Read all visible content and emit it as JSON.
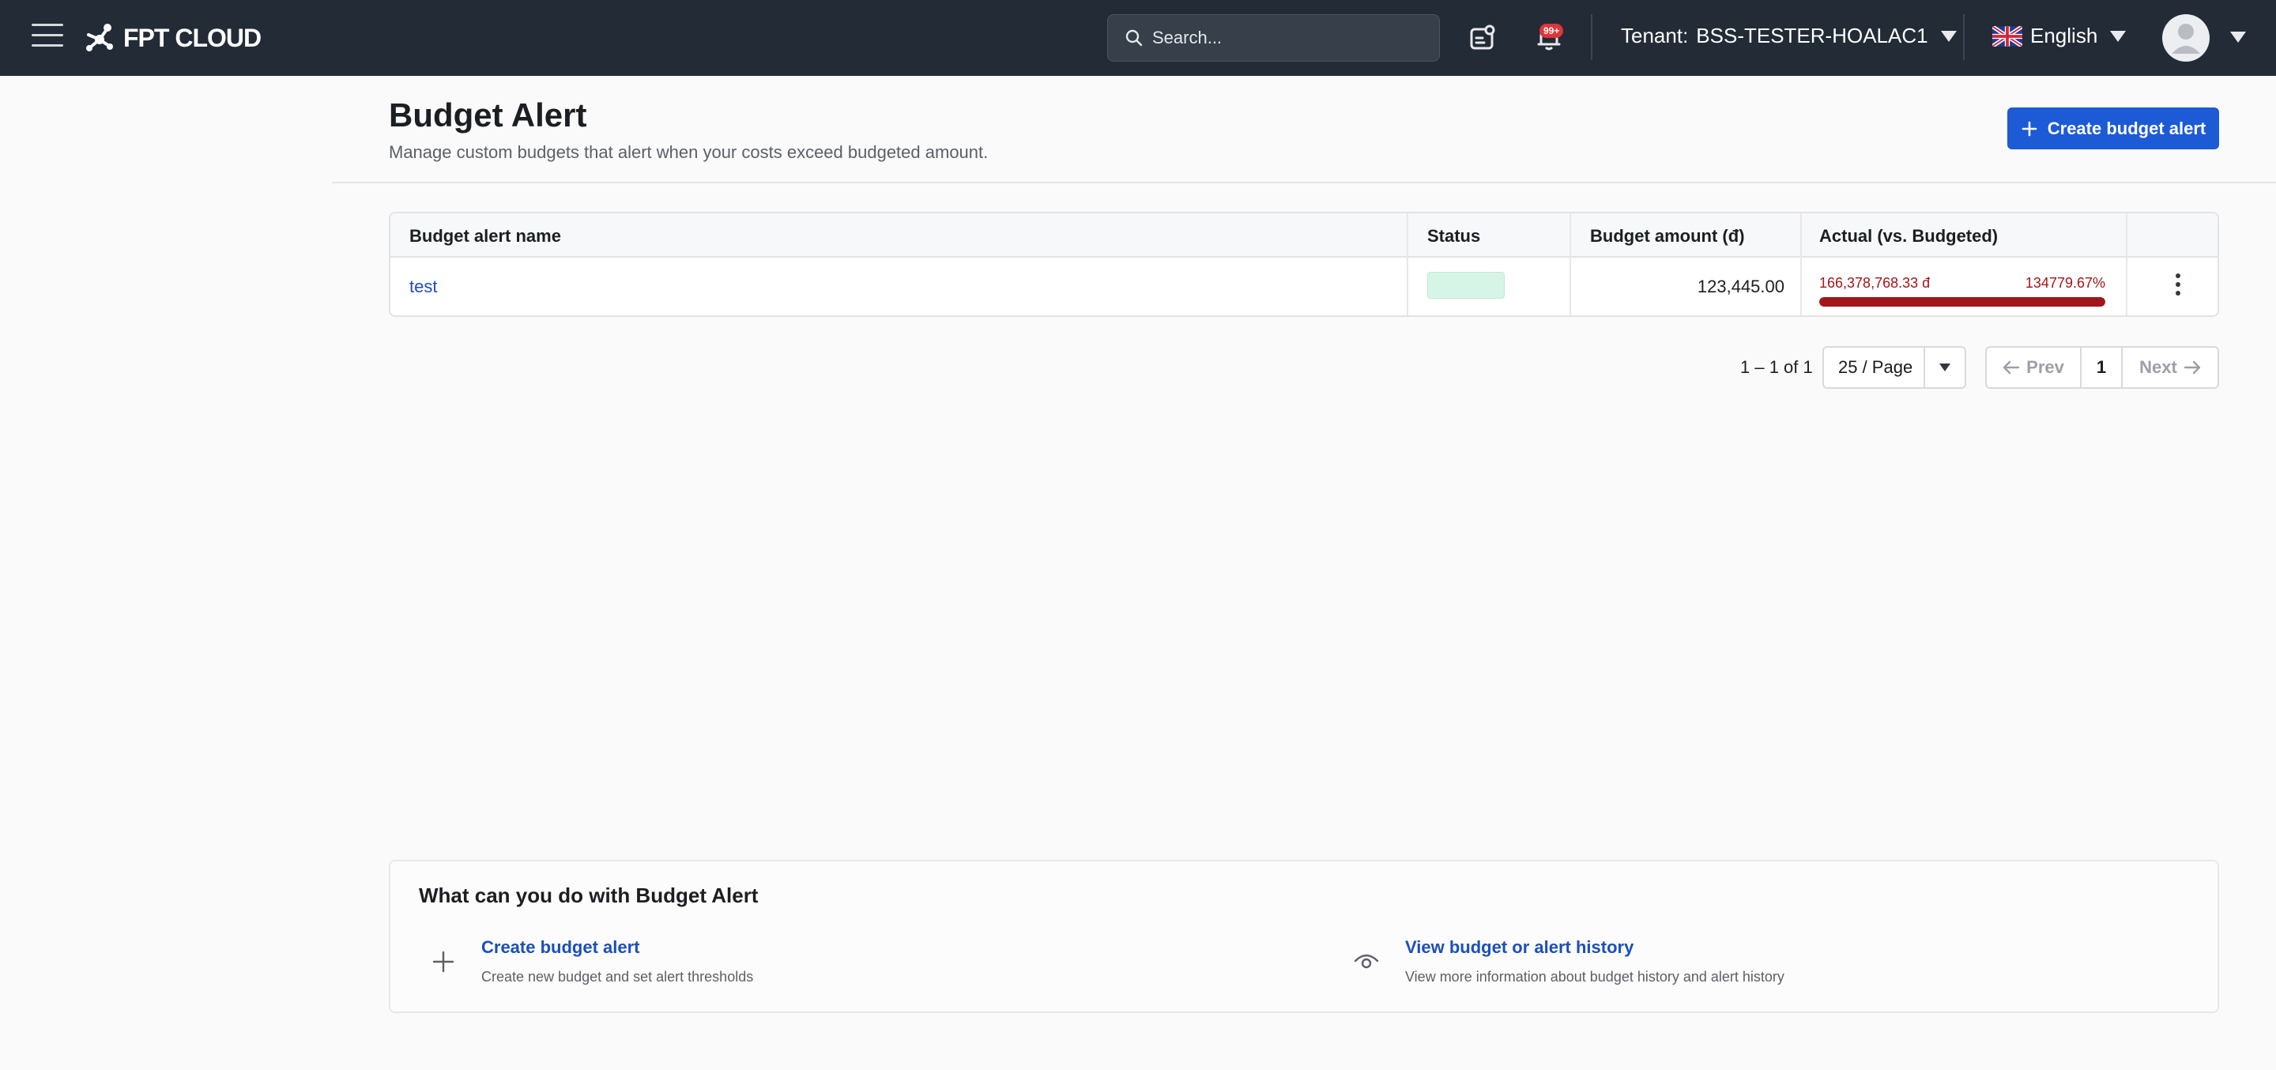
{
  "topbar": {
    "brand": "FPT CLOUD",
    "search_placeholder": "Search...",
    "notification_count": "99+",
    "tenant_label": "Tenant:",
    "tenant_value": "BSS-TESTER-HOALAC1",
    "language": "English"
  },
  "header": {
    "title": "Budget Alert",
    "subtitle": "Manage custom budgets that alert when your costs exceed budgeted amount.",
    "create_button": "Create budget alert"
  },
  "table": {
    "columns": [
      "Budget alert name",
      "Status",
      "Budget amount (đ)",
      "Actual (vs. Budgeted)"
    ],
    "rows": [
      {
        "name": "test",
        "status_color": "#d7f5e6",
        "budget_amount": "123,445.00",
        "actual_amount": "166,378,768.33 đ",
        "actual_percent": "134779.67%",
        "progress_fraction": 1.0
      }
    ]
  },
  "pagination": {
    "range": "1 – 1 of 1",
    "page_size": "25 / Page",
    "prev": "Prev",
    "current": "1",
    "next": "Next"
  },
  "help": {
    "title": "What can you do with Budget Alert",
    "items": [
      {
        "title": "Create budget alert",
        "description": "Create new budget and set alert thresholds",
        "icon": "plus-icon"
      },
      {
        "title": "View budget or alert history",
        "description": "View more information about budget history and alert history",
        "icon": "eye-icon"
      }
    ]
  },
  "colors": {
    "topbar_bg": "#222b36",
    "primary": "#1c5ad6",
    "danger": "#a1161b"
  }
}
